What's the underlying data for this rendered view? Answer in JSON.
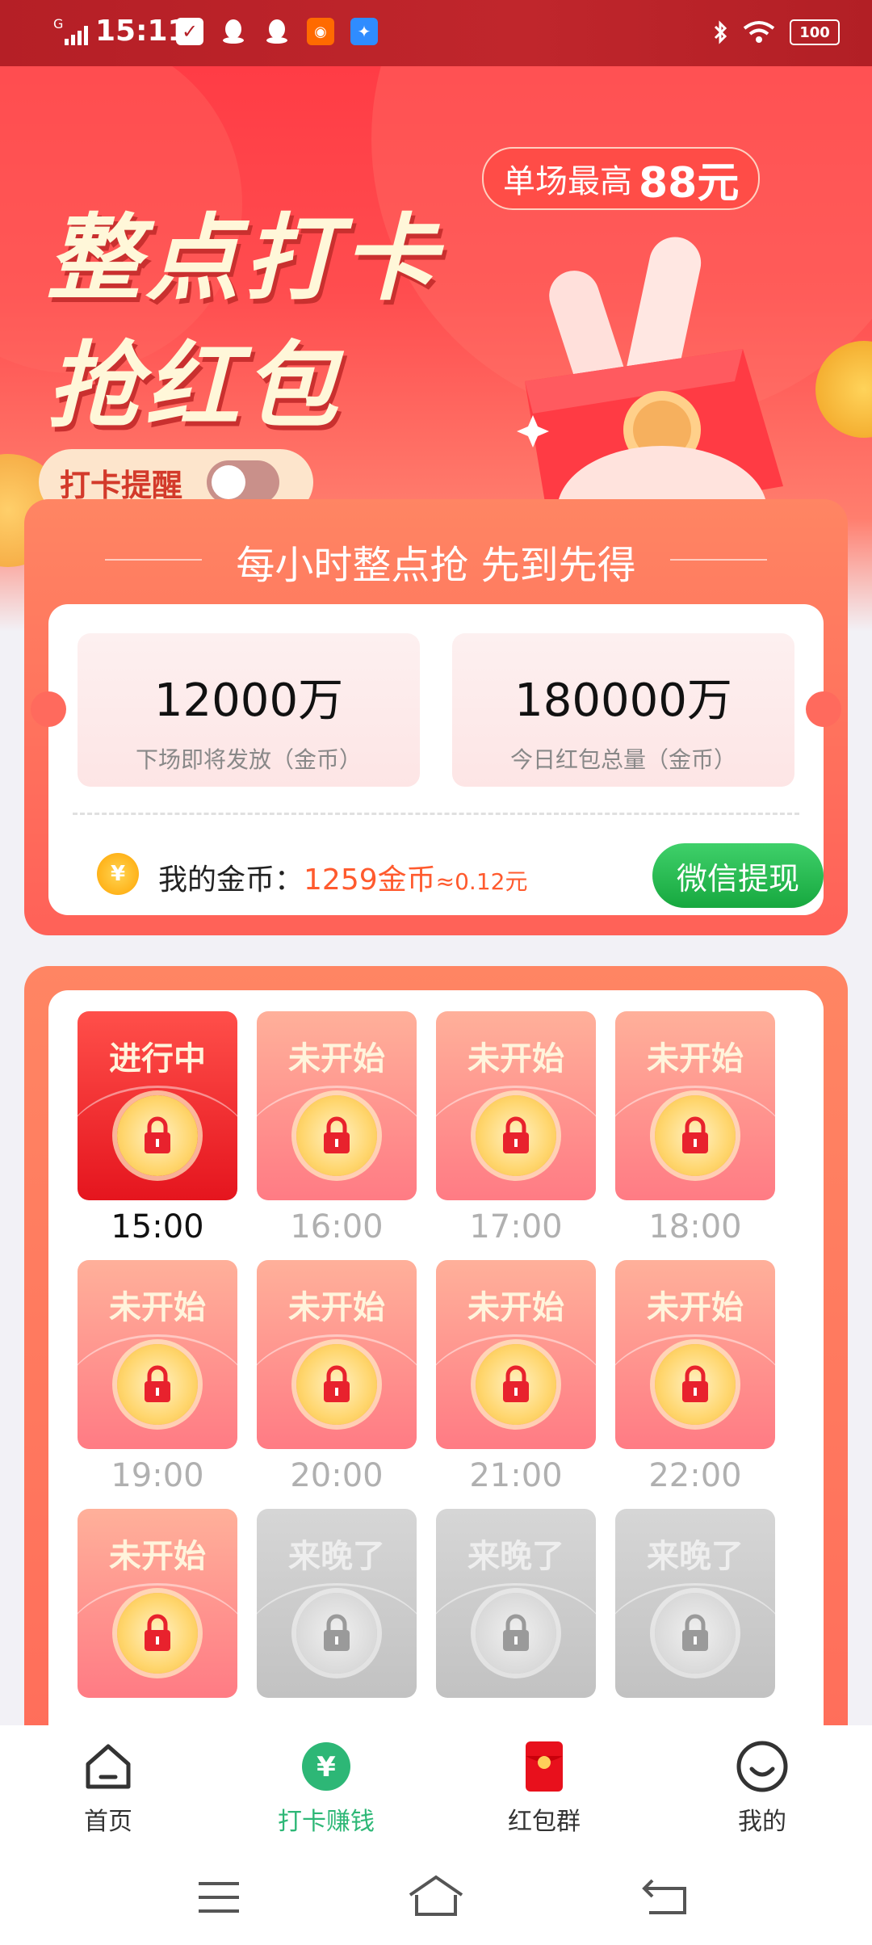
{
  "status_bar": {
    "time": "15:11",
    "signal_label": "G",
    "battery": "100"
  },
  "hero": {
    "badge_prefix": "单场最高",
    "badge_amount": "88元",
    "title_line1": "整点打卡",
    "title_line2": "抢红包",
    "remind_label": "打卡提醒",
    "remind_on": false
  },
  "summary": {
    "headline": "每小时整点抢 先到先得",
    "next_amount": "12000万",
    "next_label": "下场即将发放（金币）",
    "total_amount": "180000万",
    "total_label": "今日红包总量（金币）",
    "coin_symbol": "¥",
    "my_coins_label": "我的金币：",
    "my_coins_value": "1259金币",
    "my_coins_approx": "≈0.12元",
    "withdraw_button": "微信提现"
  },
  "slots": [
    {
      "status": "进行中",
      "time": "15:00",
      "state": "active"
    },
    {
      "status": "未开始",
      "time": "16:00",
      "state": "pending"
    },
    {
      "status": "未开始",
      "time": "17:00",
      "state": "pending"
    },
    {
      "status": "未开始",
      "time": "18:00",
      "state": "pending"
    },
    {
      "status": "未开始",
      "time": "19:00",
      "state": "pending"
    },
    {
      "status": "未开始",
      "time": "20:00",
      "state": "pending"
    },
    {
      "status": "未开始",
      "time": "21:00",
      "state": "pending"
    },
    {
      "status": "未开始",
      "time": "22:00",
      "state": "pending"
    },
    {
      "status": "未开始",
      "time": "",
      "state": "pending"
    },
    {
      "status": "来晚了",
      "time": "",
      "state": "late"
    },
    {
      "status": "来晚了",
      "time": "",
      "state": "late"
    },
    {
      "status": "来晚了",
      "time": "",
      "state": "late"
    }
  ],
  "bottom_nav": {
    "items": [
      {
        "label": "首页",
        "icon": "home-icon"
      },
      {
        "label": "打卡赚钱",
        "icon": "yuan-coin-icon",
        "active": true
      },
      {
        "label": "红包群",
        "icon": "red-envelope-icon"
      },
      {
        "label": "我的",
        "icon": "smiley-icon"
      }
    ]
  },
  "colors": {
    "brand_red": "#ff4d4f",
    "accent_orange": "#ff6d5a",
    "active_green": "#2db776",
    "wechat_green": "#17a83f"
  }
}
